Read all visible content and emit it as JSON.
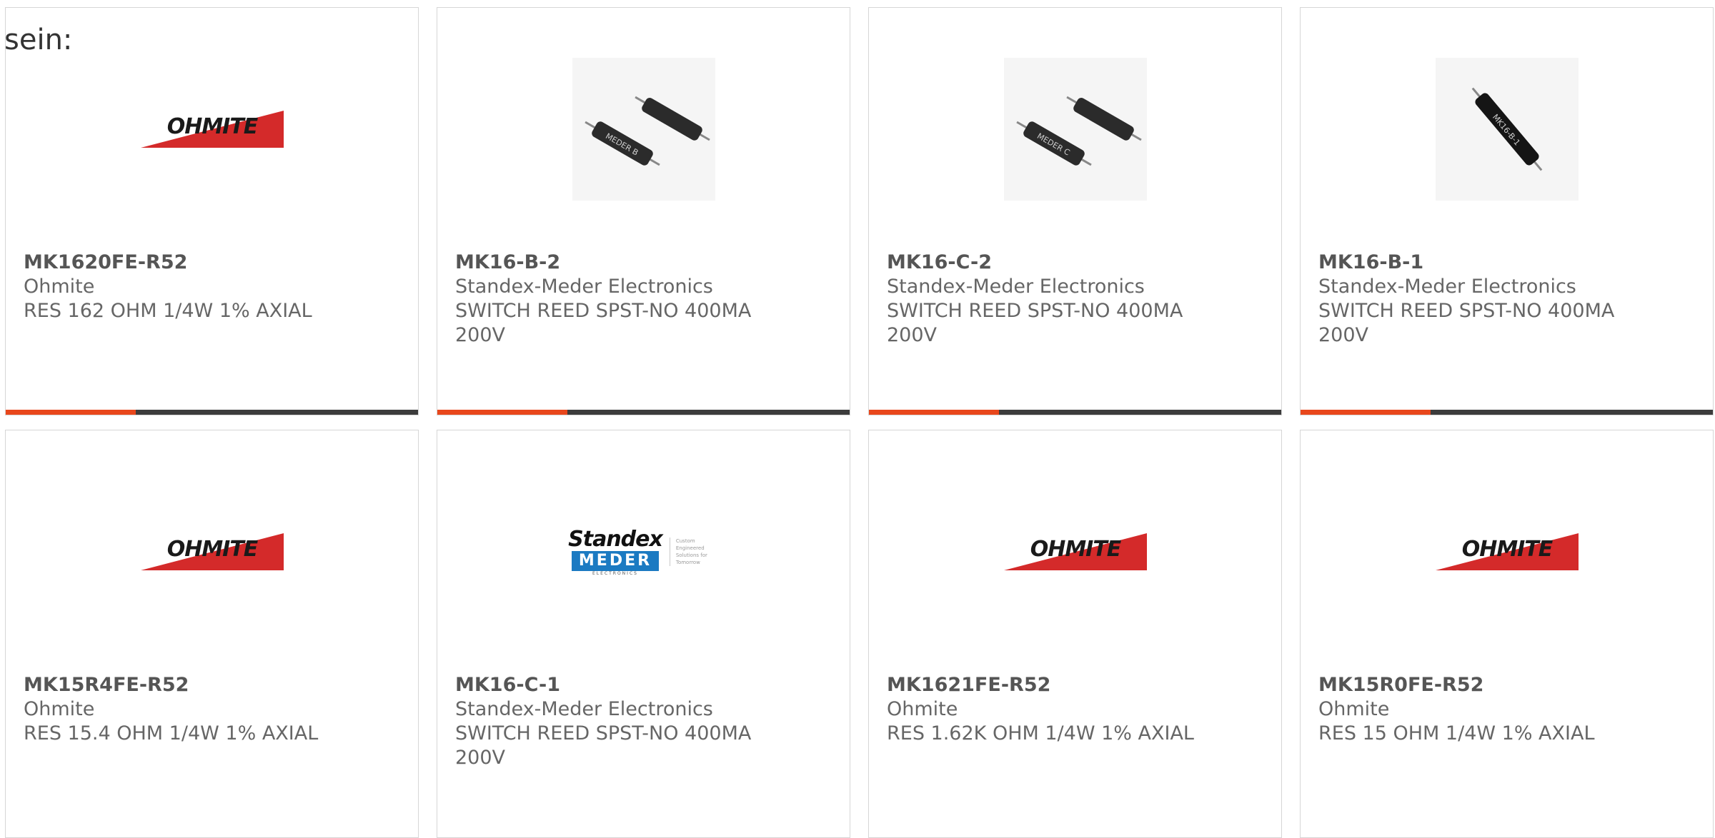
{
  "intro_text": "sein:",
  "colors": {
    "accent": "#e8471c",
    "bar": "#3c3c3c",
    "ohmite_red": "#d42a2a"
  },
  "products": [
    {
      "part_number": "MK1620FE-R52",
      "manufacturer": "Ohmite",
      "description": "RES 162 OHM 1/4W 1% AXIAL",
      "image": "ohmite-logo",
      "logo_text": "OHMITE"
    },
    {
      "part_number": "MK16-B-2",
      "manufacturer": "Standex-Meder Electronics",
      "description": "SWITCH REED SPST-NO 400MA 200V",
      "image": "reed-switch-pair-photo",
      "photo_label": "MEDER B"
    },
    {
      "part_number": "MK16-C-2",
      "manufacturer": "Standex-Meder Electronics",
      "description": "SWITCH REED SPST-NO 400MA 200V",
      "image": "reed-switch-pair-photo",
      "photo_label": "MEDER C"
    },
    {
      "part_number": "MK16-B-1",
      "manufacturer": "Standex-Meder Electronics",
      "description": "SWITCH REED SPST-NO 400MA 200V",
      "image": "reed-switch-single-photo",
      "photo_label": "MK16-B-1"
    },
    {
      "part_number": "MK15R4FE-R52",
      "manufacturer": "Ohmite",
      "description": "RES 15.4 OHM 1/4W 1% AXIAL",
      "image": "ohmite-logo",
      "logo_text": "OHMITE"
    },
    {
      "part_number": "MK16-C-1",
      "manufacturer": "Standex-Meder Electronics",
      "description": "SWITCH REED SPST-NO 400MA 200V",
      "image": "standex-meder-logo",
      "logo_top": "Standex",
      "logo_middle": "MEDER",
      "logo_bottom": "ELECTRONICS",
      "logo_tagline": "Custom Engineered Solutions for Tomorrow"
    },
    {
      "part_number": "MK1621FE-R52",
      "manufacturer": "Ohmite",
      "description": "RES 1.62K OHM 1/4W 1% AXIAL",
      "image": "ohmite-logo",
      "logo_text": "OHMITE"
    },
    {
      "part_number": "MK15R0FE-R52",
      "manufacturer": "Ohmite",
      "description": "RES 15 OHM 1/4W 1% AXIAL",
      "image": "ohmite-logo",
      "logo_text": "OHMITE"
    }
  ]
}
